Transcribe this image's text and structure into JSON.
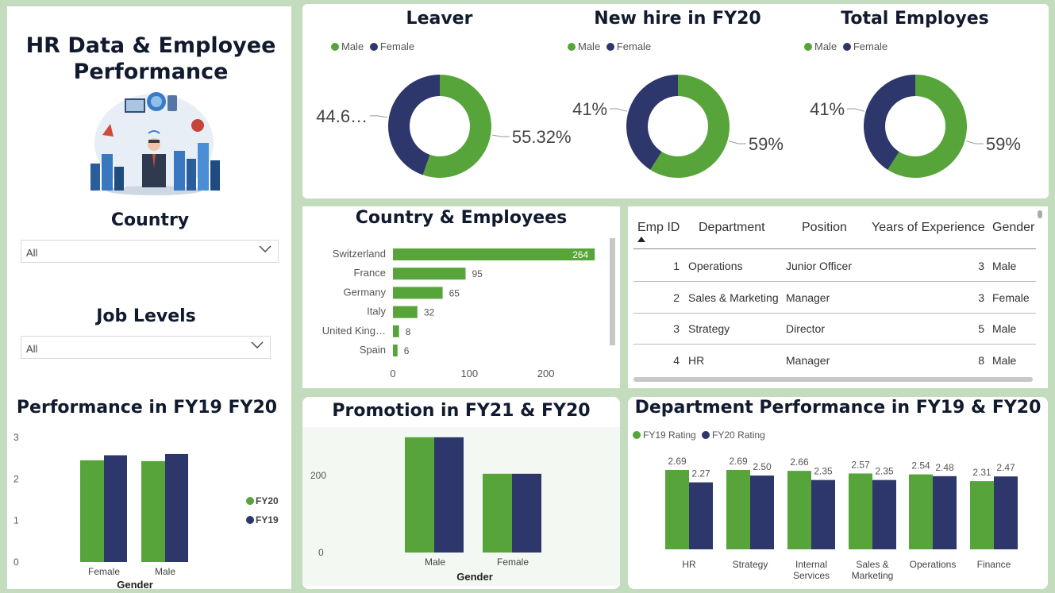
{
  "sidebar": {
    "title_line1": "HR Data & Employee",
    "title_line2": "Performance",
    "country_label": "Country",
    "country_value": "All",
    "job_levels_label": "Job Levels",
    "job_levels_value": "All",
    "perf_title": "Performance in FY19 FY20"
  },
  "donuts": [
    {
      "title": "Leaver",
      "legend": [
        "Male",
        "Female"
      ],
      "male_label": "55.32%",
      "female_label": "44.6…",
      "male_pct": 55.32,
      "female_pct": 44.68
    },
    {
      "title": "New hire in FY20",
      "legend": [
        "Male",
        "Female"
      ],
      "male_label": "59%",
      "female_label": "41%",
      "male_pct": 59,
      "female_pct": 41
    },
    {
      "title": "Total Employes",
      "legend": [
        "Male",
        "Female"
      ],
      "male_label": "59%",
      "female_label": "41%",
      "male_pct": 59,
      "female_pct": 41
    }
  ],
  "country_chart_title": "Country & Employees",
  "table": {
    "headers": [
      "Emp ID",
      "Department",
      "Position",
      "Years of Experience",
      "Gender"
    ],
    "rows": [
      [
        "1",
        "Operations",
        "Junior Officer",
        "3",
        "Male"
      ],
      [
        "2",
        "Sales & Marketing",
        "Manager",
        "3",
        "Female"
      ],
      [
        "3",
        "Strategy",
        "Director",
        "5",
        "Male"
      ],
      [
        "4",
        "HR",
        "Manager",
        "8",
        "Male"
      ]
    ]
  },
  "promotion_title": "Promotion in FY21 & FY20",
  "dept_title": "Department Performance in FY19 & FY20",
  "colors": {
    "green": "#57a53a",
    "navy": "#2d376b",
    "bg": "#c3dcbd"
  },
  "chart_data": [
    {
      "type": "pie",
      "title": "Leaver",
      "categories": [
        "Male",
        "Female"
      ],
      "values": [
        55.32,
        44.68
      ]
    },
    {
      "type": "pie",
      "title": "New hire in FY20",
      "categories": [
        "Male",
        "Female"
      ],
      "values": [
        59,
        41
      ]
    },
    {
      "type": "pie",
      "title": "Total Employes",
      "categories": [
        "Male",
        "Female"
      ],
      "values": [
        59,
        41
      ]
    },
    {
      "type": "bar",
      "title": "Country & Employees",
      "categories": [
        "Switzerland",
        "France",
        "Germany",
        "Italy",
        "United King…",
        "Spain"
      ],
      "values": [
        264,
        95,
        65,
        32,
        8,
        6
      ],
      "xticks": [
        "0",
        "100",
        "200"
      ],
      "xlim": [
        0,
        270
      ]
    },
    {
      "type": "bar",
      "title": "Performance in FY19 FY20",
      "xlabel": "Gender",
      "categories": [
        "Female",
        "Male"
      ],
      "series": [
        {
          "name": "FY20",
          "values": [
            2.45,
            2.43
          ]
        },
        {
          "name": "FY19",
          "values": [
            2.57,
            2.6
          ]
        }
      ],
      "yticks": [
        "0",
        "1",
        "2",
        "3"
      ],
      "ylim": [
        0,
        3
      ],
      "legend": [
        "FY20",
        "FY19"
      ]
    },
    {
      "type": "bar",
      "title": "Promotion in FY21 & FY20",
      "xlabel": "Gender",
      "categories": [
        "Male",
        "Female"
      ],
      "series": [
        {
          "values": [
            300,
            205
          ]
        },
        {
          "values": [
            300,
            205
          ]
        }
      ],
      "yticks": [
        "0",
        "200"
      ],
      "ylim": [
        0,
        310
      ]
    },
    {
      "type": "bar",
      "title": "Department Performance in FY19 & FY20",
      "categories": [
        "HR",
        "Strategy",
        "Internal Services",
        "Sales & Marketing",
        "Operations",
        "Finance"
      ],
      "series": [
        {
          "name": "FY19 Rating",
          "values": [
            2.69,
            2.69,
            2.66,
            2.57,
            2.54,
            2.31
          ]
        },
        {
          "name": "FY20 Rating",
          "values": [
            2.27,
            2.5,
            2.35,
            2.35,
            2.48,
            2.47
          ]
        }
      ],
      "labels_fy19": [
        "2.69",
        "2.69",
        "2.66",
        "2.57",
        "2.54",
        "2.31"
      ],
      "labels_fy20": [
        "2.27",
        "2.50",
        "2.35",
        "2.35",
        "2.48",
        "2.47"
      ],
      "legend": [
        "FY19 Rating",
        "FY20 Rating"
      ]
    }
  ]
}
